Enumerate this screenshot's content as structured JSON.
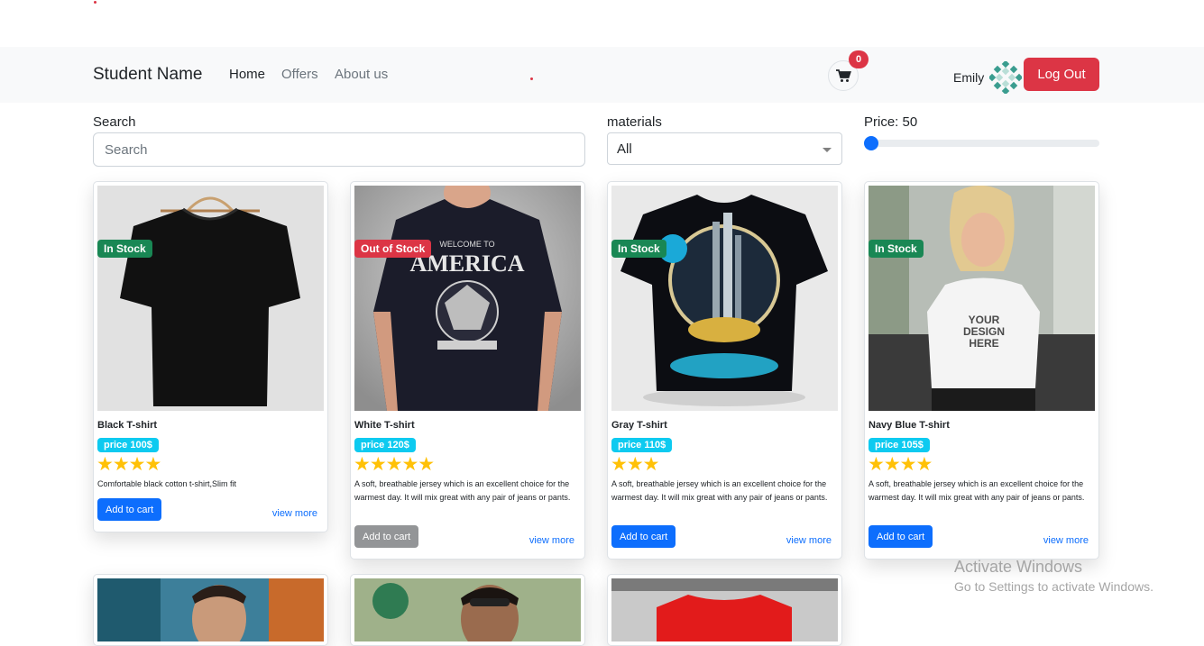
{
  "navbar": {
    "brand": "Student Name",
    "links": [
      "Home",
      "Offers",
      "About us"
    ],
    "cart_count": "0",
    "username": "Emily",
    "logout_label": "Log Out"
  },
  "filters": {
    "search_label": "Search",
    "search_placeholder": "Search",
    "materials_label": "materials",
    "materials_selected": "All",
    "price_label": "Price: 50",
    "price_value": 50
  },
  "products": [
    {
      "title": "Black T-shirt",
      "stock": "In Stock",
      "price": "price 100$",
      "stars": "★★★★",
      "description": "Comfortable black cotton t-shirt,Slim fit",
      "add_label": "Add to cart",
      "view_more": "view more"
    },
    {
      "title": "White T-shirt",
      "stock": "Out of Stock",
      "price": "price 120$",
      "stars": "★★★★★",
      "description": "A soft, breathable jersey which is an excellent choice for the warmest day. It will mix great with any pair of jeans or pants.",
      "add_label": "Add to cart",
      "view_more": "view more",
      "shirt_text_1": "WELCOME TO",
      "shirt_text_2": "AMERICA"
    },
    {
      "title": "Gray T-shirt",
      "stock": "In Stock",
      "price": "price 110$",
      "stars": "★★★",
      "description": "A soft, breathable jersey which is an excellent choice for the warmest day. It will mix great with any pair of jeans or pants.",
      "add_label": "Add to cart",
      "view_more": "view more"
    },
    {
      "title": "Navy Blue T-shirt",
      "stock": "In Stock",
      "price": "price 105$",
      "stars": "★★★★",
      "description": "A soft, breathable jersey which is an excellent choice for the warmest day. It will mix great with any pair of jeans or pants.",
      "add_label": "Add to cart",
      "view_more": "view more",
      "shirt_text": "YOUR DESIGN HERE"
    }
  ],
  "colors": {
    "in_stock": "#198754",
    "out_of_stock": "#dc3545",
    "primary": "#0d6efd",
    "disabled": "#6c757d",
    "price_badge": "#0dcaf0",
    "star": "#ffc107"
  },
  "watermark": {
    "line1": "Activate Windows",
    "line2": "Go to Settings to activate Windows."
  }
}
